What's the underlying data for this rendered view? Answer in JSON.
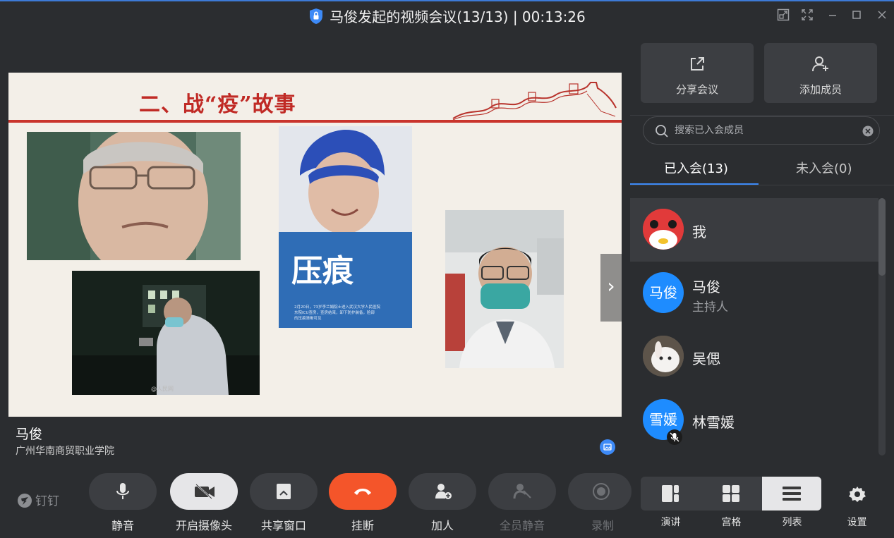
{
  "window": {
    "title": "马俊发起的视频会议(13/13) | 00:13:26"
  },
  "slide": {
    "title": "二、战“疫”故事",
    "poster_text": "压痕"
  },
  "speaker": {
    "name": "马俊",
    "org": "广州华南商贸职业学院"
  },
  "panel": {
    "share_label": "分享会议",
    "add_member_label": "添加成员",
    "search_placeholder": "搜索已入会成员",
    "tab_joined": "已入会(13)",
    "tab_not_joined": "未入会(0)",
    "members": [
      {
        "name": "我",
        "role": ""
      },
      {
        "name": "马俊",
        "role": "主持人",
        "avatar_text": "马俊"
      },
      {
        "name": "吴偲",
        "role": ""
      },
      {
        "name": "林雪媛",
        "role": "",
        "avatar_text": "雪媛"
      }
    ]
  },
  "toolbar": {
    "brand": "钉钉",
    "mute_label": "静音",
    "camera_label": "开启摄像头",
    "share_window_label": "共享窗口",
    "hangup_label": "挂断",
    "invite_label": "加人",
    "mute_all_label": "全员静音",
    "record_label": "录制",
    "view_speaker_label": "演讲",
    "view_grid_label": "宫格",
    "view_list_label": "列表",
    "settings_label": "设置"
  },
  "colors": {
    "accent": "#3d8af7",
    "hangup": "#f4552a",
    "slide_red": "#c02a25"
  }
}
